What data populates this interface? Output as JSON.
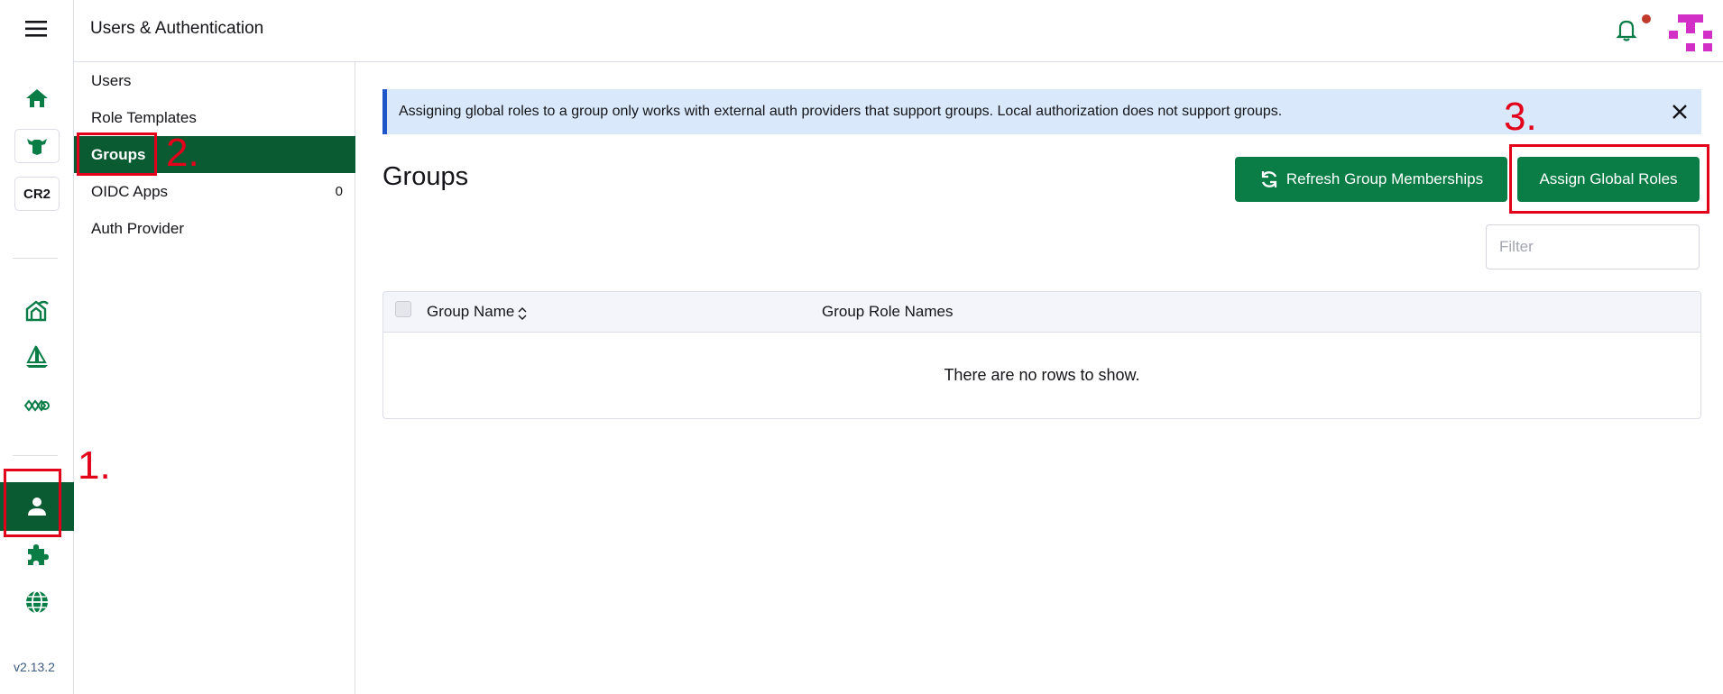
{
  "header": {
    "title": "Users & Authentication"
  },
  "rail": {
    "chip_label": "CR2",
    "version": "v2.13.2",
    "icons": [
      "home-icon",
      "cluster-icon",
      "cr2-cluster-chip",
      "fleet-icon",
      "helm-icon",
      "network-icon",
      "user-icon",
      "extensions-icon",
      "globe-icon"
    ]
  },
  "subnav": {
    "items": [
      {
        "label": "Users"
      },
      {
        "label": "Role Templates"
      },
      {
        "label": "Groups"
      },
      {
        "label": "OIDC Apps",
        "count": "0"
      },
      {
        "label": "Auth Provider"
      }
    ],
    "active": "Groups"
  },
  "banner": {
    "text": "Assigning global roles to a group only works with external auth providers that support groups. Local authorization does not support groups."
  },
  "main": {
    "title": "Groups",
    "refresh_label": "Refresh Group Memberships",
    "assign_label": "Assign Global Roles",
    "filter_placeholder": "Filter"
  },
  "table": {
    "columns": [
      "Group Name",
      "Group Role Names"
    ],
    "empty_text": "There are no rows to show."
  },
  "annotations": [
    "1.",
    "2.",
    "3."
  ],
  "colors": {
    "brand": "#0a7d46",
    "active_nav": "#0a5a32",
    "banner_bg": "#d9e9fb",
    "banner_border": "#1e56c8",
    "annotation": "#e3001b",
    "avatar": "#d12fc6"
  }
}
